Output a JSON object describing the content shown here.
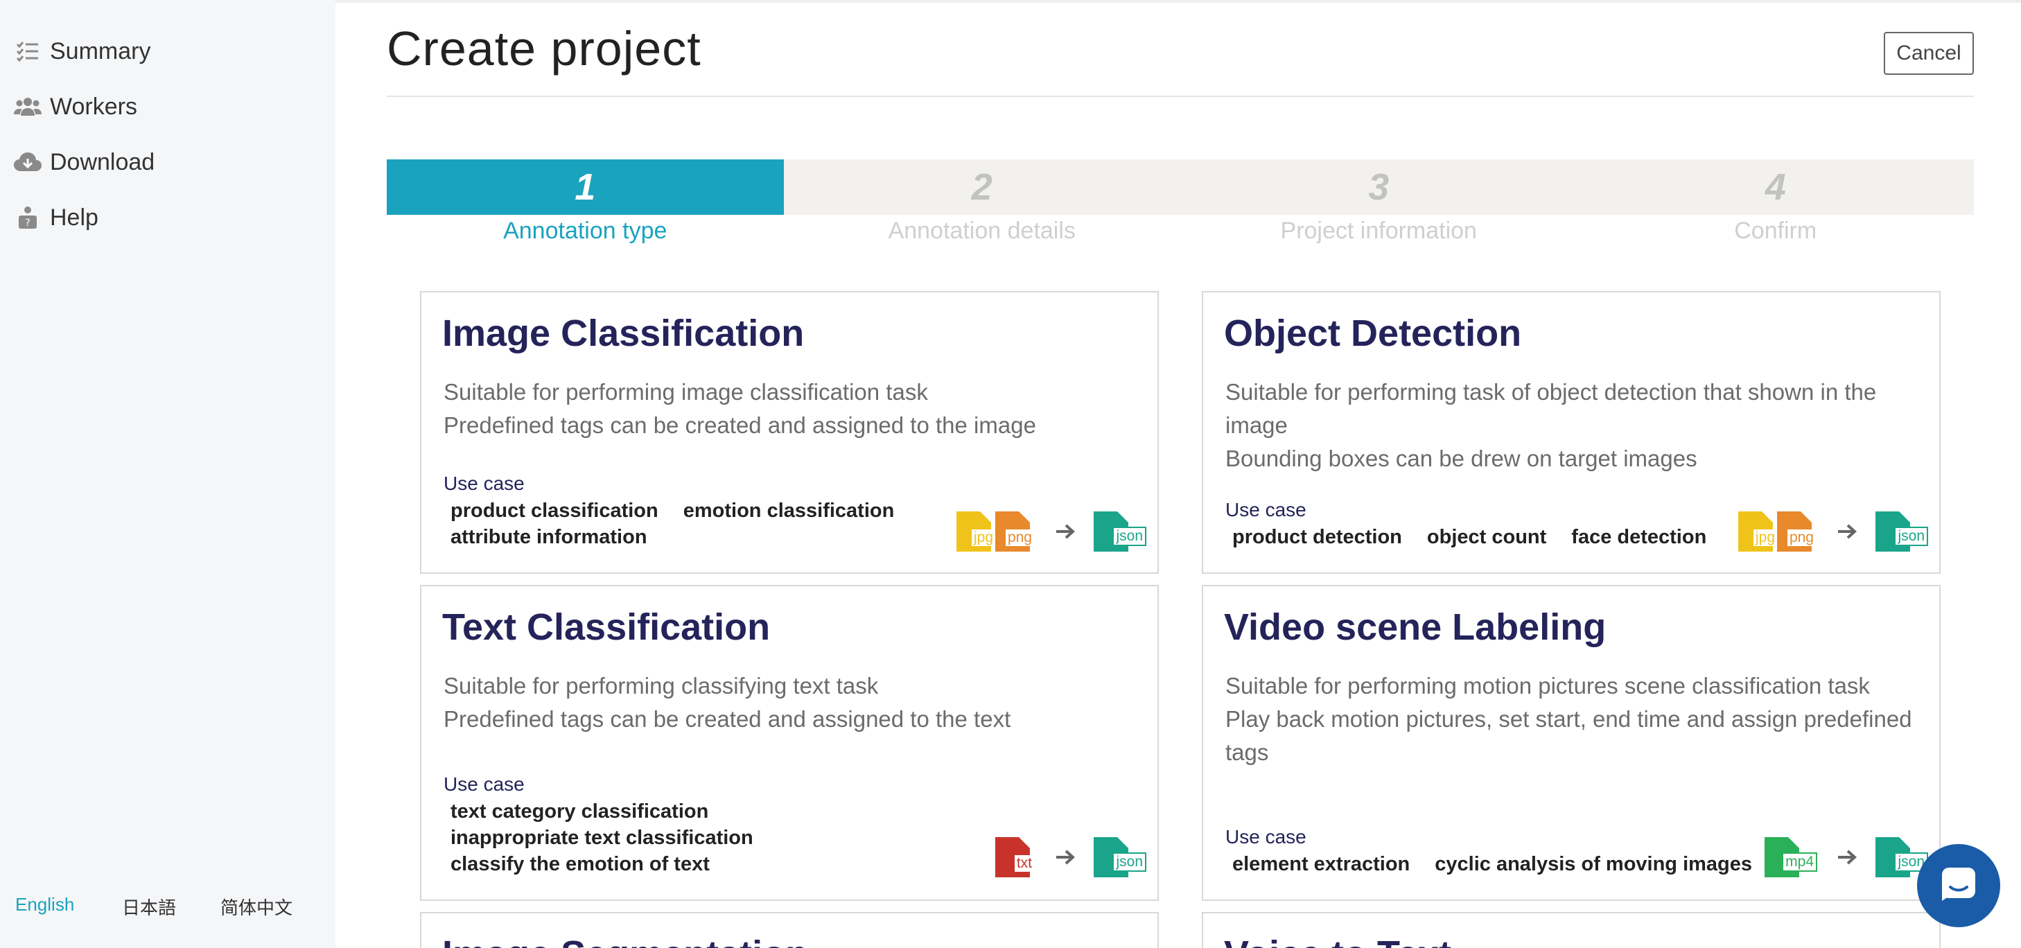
{
  "sidebar": {
    "items": [
      {
        "label": "Summary",
        "icon": "list-check-icon"
      },
      {
        "label": "Workers",
        "icon": "users-icon"
      },
      {
        "label": "Download",
        "icon": "cloud-download-icon"
      },
      {
        "label": "Help",
        "icon": "help-person-icon"
      }
    ],
    "languages": [
      {
        "label": "English",
        "active": true
      },
      {
        "label": "日本語",
        "active": false
      },
      {
        "label": "简体中文",
        "active": false
      }
    ]
  },
  "header": {
    "title": "Create project",
    "cancel_label": "Cancel"
  },
  "stepper": {
    "steps": [
      {
        "num": "1",
        "label": "Annotation type",
        "active": true
      },
      {
        "num": "2",
        "label": "Annotation details",
        "active": false
      },
      {
        "num": "3",
        "label": "Project information",
        "active": false
      },
      {
        "num": "4",
        "label": "Confirm",
        "active": false
      }
    ]
  },
  "cards": [
    {
      "title": "Image Classification",
      "desc": [
        "Suitable for performing image classification task",
        "Predefined tags can be created and assigned to the image"
      ],
      "use_case_label": "Use case",
      "use_cases": [
        "product classification",
        "emotion classification",
        "attribute information"
      ],
      "inputs": [
        "jpg",
        "png"
      ],
      "output": "json"
    },
    {
      "title": "Object Detection",
      "desc": [
        "Suitable for performing task of object detection that shown in the image",
        "Bounding boxes can be drew on target images"
      ],
      "use_case_label": "Use case",
      "use_cases": [
        "product detection",
        "object count",
        "face detection"
      ],
      "inputs": [
        "jpg",
        "png"
      ],
      "output": "json"
    },
    {
      "title": "Text Classification",
      "desc": [
        "Suitable for performing classifying text task",
        "Predefined tags can be created and assigned to the text"
      ],
      "use_case_label": "Use case",
      "use_cases": [
        "text category classification",
        "inappropriate text classification",
        "classify the emotion of text"
      ],
      "inputs": [
        "txt"
      ],
      "output": "json"
    },
    {
      "title": "Video scene Labeling",
      "desc": [
        "Suitable for performing motion pictures scene classification task",
        "Play back motion pictures, set start, end time and assign predefined tags"
      ],
      "use_case_label": "Use case",
      "use_cases": [
        "element extraction",
        "cyclic analysis of moving images"
      ],
      "inputs": [
        "mp4"
      ],
      "output": "json"
    },
    {
      "title": "Image Segmentation",
      "partial": true
    },
    {
      "title": "Voice to Text",
      "partial": true
    }
  ],
  "colors": {
    "accent": "#1aa3bf",
    "title_navy": "#24235a",
    "jpg": "#f0c31a",
    "png": "#e8892b",
    "json": "#1aa58a",
    "txt": "#c7332a",
    "mp4": "#2bb05a",
    "chat": "#1a5ca8"
  }
}
